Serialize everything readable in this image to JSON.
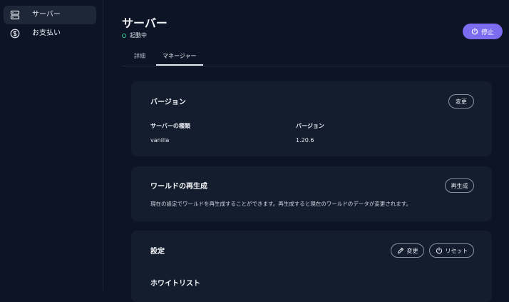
{
  "sidebar": {
    "items": [
      {
        "label": "サーバー",
        "icon": "server-icon",
        "active": true
      },
      {
        "label": "お支払い",
        "icon": "dollar-circle-icon",
        "active": false
      }
    ]
  },
  "header": {
    "title": "サーバー",
    "status": "起動中",
    "stop_label": "停止"
  },
  "tabs": [
    {
      "label": "詳細",
      "active": false
    },
    {
      "label": "マネージャー",
      "active": true
    }
  ],
  "version_card": {
    "title": "バージョン",
    "change_label": "変更",
    "type_label": "サーバーの種類",
    "type_value": "vanilla",
    "version_label": "バージョン",
    "version_value": "1.20.6"
  },
  "regen_card": {
    "title": "ワールドの再生成",
    "button_label": "再生成",
    "description": "現在の設定でワールドを再生成することができます。再生成すると現在のワールドのデータが変更されます。"
  },
  "settings_card": {
    "title": "設定",
    "change_label": "変更",
    "reset_label": "リセット",
    "whitelist_label": "ホワイトリスト"
  },
  "colors": {
    "accent": "#7b6cf0",
    "status_ok": "#34c98a",
    "background": "#0c1426",
    "card": "#141d2e"
  }
}
